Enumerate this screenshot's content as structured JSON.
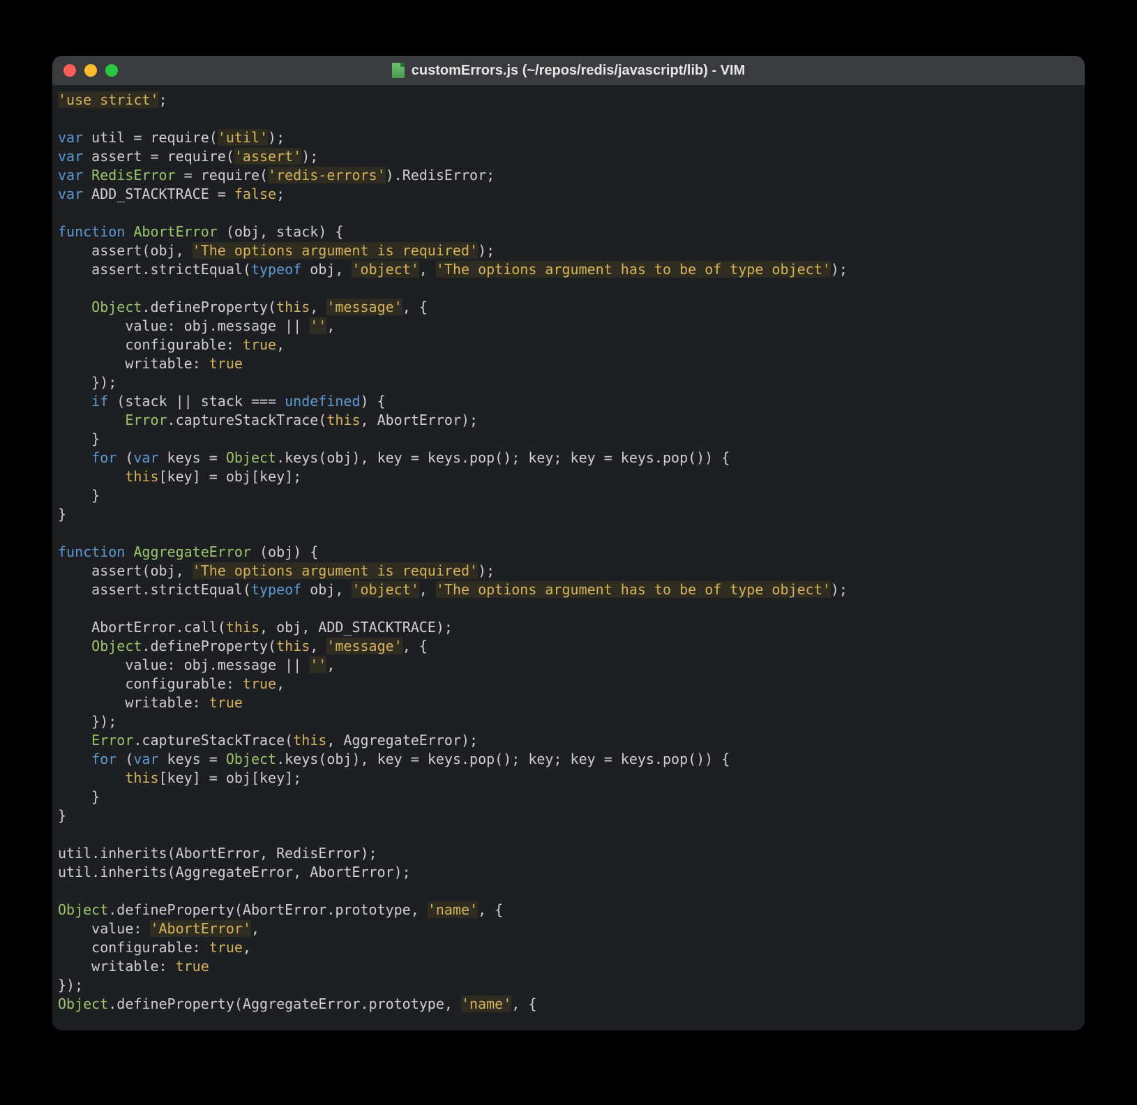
{
  "window": {
    "title": "customErrors.js (~/repos/redis/javascript/lib) - VIM"
  },
  "code": {
    "lines": [
      [
        [
          "str",
          "'use strict'"
        ],
        [
          "punc",
          ";"
        ]
      ],
      [],
      [
        [
          "kw",
          "var"
        ],
        [
          "punc",
          " util = require("
        ],
        [
          "str",
          "'util'"
        ],
        [
          "punc",
          ");"
        ]
      ],
      [
        [
          "kw",
          "var"
        ],
        [
          "punc",
          " assert = require("
        ],
        [
          "str",
          "'assert'"
        ],
        [
          "punc",
          ");"
        ]
      ],
      [
        [
          "kw",
          "var"
        ],
        [
          "punc",
          " "
        ],
        [
          "fn",
          "RedisError"
        ],
        [
          "punc",
          " = require("
        ],
        [
          "str",
          "'redis-errors'"
        ],
        [
          "punc",
          ").RedisError;"
        ]
      ],
      [
        [
          "kw",
          "var"
        ],
        [
          "punc",
          " ADD_STACKTRACE = "
        ],
        [
          "lit",
          "false"
        ],
        [
          "punc",
          ";"
        ]
      ],
      [],
      [
        [
          "kw",
          "function"
        ],
        [
          "punc",
          " "
        ],
        [
          "fn",
          "AbortError"
        ],
        [
          "punc",
          " (obj, stack) {"
        ]
      ],
      [
        [
          "punc",
          "    assert(obj, "
        ],
        [
          "str",
          "'The options argument is required'"
        ],
        [
          "punc",
          ");"
        ]
      ],
      [
        [
          "punc",
          "    assert.strictEqual("
        ],
        [
          "kw",
          "typeof"
        ],
        [
          "punc",
          " obj, "
        ],
        [
          "str",
          "'object'"
        ],
        [
          "punc",
          ", "
        ],
        [
          "str",
          "'The options argument has to be of type object'"
        ],
        [
          "punc",
          ");"
        ]
      ],
      [],
      [
        [
          "punc",
          "    "
        ],
        [
          "fn",
          "Object"
        ],
        [
          "punc",
          ".defineProperty("
        ],
        [
          "this",
          "this"
        ],
        [
          "punc",
          ", "
        ],
        [
          "str",
          "'message'"
        ],
        [
          "punc",
          ", {"
        ]
      ],
      [
        [
          "punc",
          "        value: obj.message || "
        ],
        [
          "str",
          "''"
        ],
        [
          "punc",
          ","
        ]
      ],
      [
        [
          "punc",
          "        configurable: "
        ],
        [
          "lit",
          "true"
        ],
        [
          "punc",
          ","
        ]
      ],
      [
        [
          "punc",
          "        writable: "
        ],
        [
          "lit",
          "true"
        ]
      ],
      [
        [
          "punc",
          "    });"
        ]
      ],
      [
        [
          "punc",
          "    "
        ],
        [
          "kw",
          "if"
        ],
        [
          "punc",
          " (stack || stack === "
        ],
        [
          "kw",
          "undefined"
        ],
        [
          "punc",
          ") {"
        ]
      ],
      [
        [
          "punc",
          "        "
        ],
        [
          "fn",
          "Error"
        ],
        [
          "punc",
          ".captureStackTrace("
        ],
        [
          "this",
          "this"
        ],
        [
          "punc",
          ", AbortError);"
        ]
      ],
      [
        [
          "punc",
          "    }"
        ]
      ],
      [
        [
          "punc",
          "    "
        ],
        [
          "kw",
          "for"
        ],
        [
          "punc",
          " ("
        ],
        [
          "kw",
          "var"
        ],
        [
          "punc",
          " keys = "
        ],
        [
          "fn",
          "Object"
        ],
        [
          "punc",
          ".keys(obj), key = keys.pop(); key; key = keys.pop()) {"
        ]
      ],
      [
        [
          "punc",
          "        "
        ],
        [
          "this",
          "this"
        ],
        [
          "punc",
          "[key] = obj[key];"
        ]
      ],
      [
        [
          "punc",
          "    }"
        ]
      ],
      [
        [
          "punc",
          "}"
        ]
      ],
      [],
      [
        [
          "kw",
          "function"
        ],
        [
          "punc",
          " "
        ],
        [
          "fn",
          "AggregateError"
        ],
        [
          "punc",
          " (obj) {"
        ]
      ],
      [
        [
          "punc",
          "    assert(obj, "
        ],
        [
          "str",
          "'The options argument is required'"
        ],
        [
          "punc",
          ");"
        ]
      ],
      [
        [
          "punc",
          "    assert.strictEqual("
        ],
        [
          "kw",
          "typeof"
        ],
        [
          "punc",
          " obj, "
        ],
        [
          "str",
          "'object'"
        ],
        [
          "punc",
          ", "
        ],
        [
          "str",
          "'The options argument has to be of type object'"
        ],
        [
          "punc",
          ");"
        ]
      ],
      [],
      [
        [
          "punc",
          "    AbortError.call("
        ],
        [
          "this",
          "this"
        ],
        [
          "punc",
          ", obj, ADD_STACKTRACE);"
        ]
      ],
      [
        [
          "punc",
          "    "
        ],
        [
          "fn",
          "Object"
        ],
        [
          "punc",
          ".defineProperty("
        ],
        [
          "this",
          "this"
        ],
        [
          "punc",
          ", "
        ],
        [
          "str",
          "'message'"
        ],
        [
          "punc",
          ", {"
        ]
      ],
      [
        [
          "punc",
          "        value: obj.message || "
        ],
        [
          "str",
          "''"
        ],
        [
          "punc",
          ","
        ]
      ],
      [
        [
          "punc",
          "        configurable: "
        ],
        [
          "lit",
          "true"
        ],
        [
          "punc",
          ","
        ]
      ],
      [
        [
          "punc",
          "        writable: "
        ],
        [
          "lit",
          "true"
        ]
      ],
      [
        [
          "punc",
          "    });"
        ]
      ],
      [
        [
          "punc",
          "    "
        ],
        [
          "fn",
          "Error"
        ],
        [
          "punc",
          ".captureStackTrace("
        ],
        [
          "this",
          "this"
        ],
        [
          "punc",
          ", AggregateError);"
        ]
      ],
      [
        [
          "punc",
          "    "
        ],
        [
          "kw",
          "for"
        ],
        [
          "punc",
          " ("
        ],
        [
          "kw",
          "var"
        ],
        [
          "punc",
          " keys = "
        ],
        [
          "fn",
          "Object"
        ],
        [
          "punc",
          ".keys(obj), key = keys.pop(); key; key = keys.pop()) {"
        ]
      ],
      [
        [
          "punc",
          "        "
        ],
        [
          "this",
          "this"
        ],
        [
          "punc",
          "[key] = obj[key];"
        ]
      ],
      [
        [
          "punc",
          "    }"
        ]
      ],
      [
        [
          "punc",
          "}"
        ]
      ],
      [],
      [
        [
          "punc",
          "util.inherits(AbortError, RedisError);"
        ]
      ],
      [
        [
          "punc",
          "util.inherits(AggregateError, AbortError);"
        ]
      ],
      [],
      [
        [
          "fn",
          "Object"
        ],
        [
          "punc",
          ".defineProperty(AbortError.prototype, "
        ],
        [
          "str",
          "'name'"
        ],
        [
          "punc",
          ", {"
        ]
      ],
      [
        [
          "punc",
          "    value: "
        ],
        [
          "str",
          "'AbortError'"
        ],
        [
          "punc",
          ","
        ]
      ],
      [
        [
          "punc",
          "    configurable: "
        ],
        [
          "lit",
          "true"
        ],
        [
          "punc",
          ","
        ]
      ],
      [
        [
          "punc",
          "    writable: "
        ],
        [
          "lit",
          "true"
        ]
      ],
      [
        [
          "punc",
          "});"
        ]
      ],
      [
        [
          "fn",
          "Object"
        ],
        [
          "punc",
          ".defineProperty(AggregateError.prototype, "
        ],
        [
          "str",
          "'name'"
        ],
        [
          "punc",
          ", {"
        ]
      ]
    ]
  }
}
